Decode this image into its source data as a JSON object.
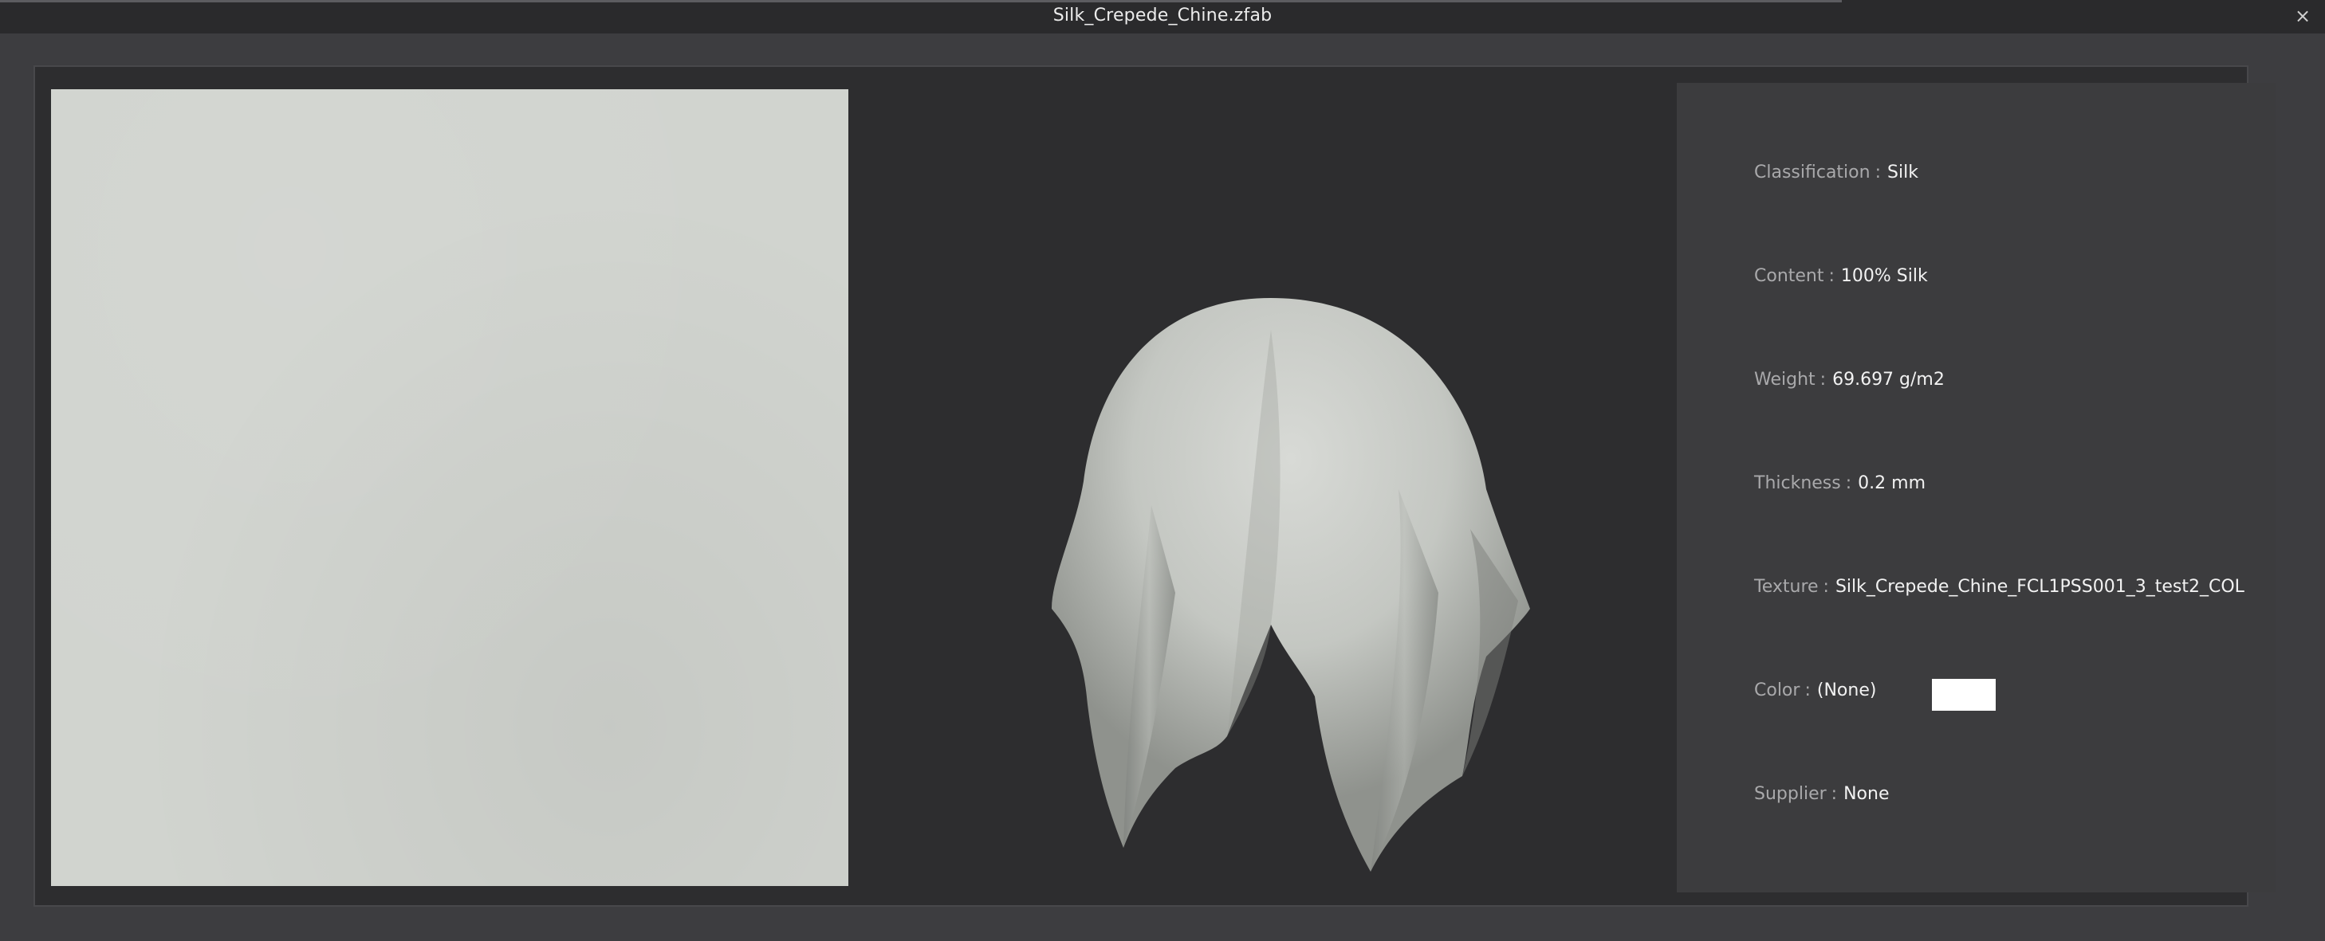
{
  "window": {
    "title": "Silk_Crepede_Chine.zfab",
    "close_glyph": "×"
  },
  "info": {
    "separator": ":",
    "rows": [
      {
        "key": "Classification",
        "value": "Silk"
      },
      {
        "key": "Content",
        "value": "100% Silk"
      },
      {
        "key": "Weight",
        "value": "69.697 g/m2"
      },
      {
        "key": "Thickness",
        "value": "0.2 mm"
      },
      {
        "key": "Texture",
        "value": "Silk_Crepede_Chine_FCL1PSS001_3_test2_COL"
      },
      {
        "key": "Color",
        "value": "(None)"
      },
      {
        "key": "Supplier",
        "value": "None"
      }
    ],
    "color_chip": "#ffffff"
  },
  "colors": {
    "fabric": "#d1d4cf",
    "background": "#2d2d2f",
    "panel": "#3c3c3e"
  }
}
